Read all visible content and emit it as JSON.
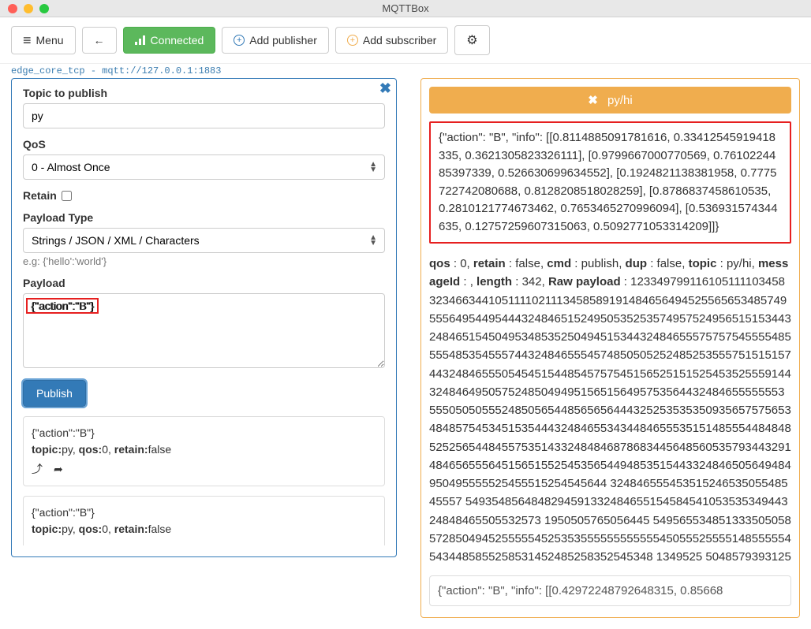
{
  "window": {
    "title": "MQTTBox"
  },
  "toolbar": {
    "menu": "Menu",
    "connected": "Connected",
    "add_publisher": "Add publisher",
    "add_subscriber": "Add subscriber"
  },
  "connstr": "edge_core_tcp - mqtt://127.0.0.1:1883",
  "publisher": {
    "topic_label": "Topic to publish",
    "topic_value": "py",
    "qos_label": "QoS",
    "qos_value": "0 - Almost Once",
    "retain_label": "Retain",
    "payload_type_label": "Payload Type",
    "payload_type_value": "Strings / JSON / XML / Characters",
    "payload_type_hint": "e.g: {'hello':'world'}",
    "payload_label": "Payload",
    "payload_value": "{\"action\":\"B\"}",
    "publish_button": "Publish"
  },
  "history": [
    {
      "payload": "{\"action\":\"B\"}",
      "topic_label": "topic:",
      "topic": "py",
      "qos_label": "qos:",
      "qos": "0",
      "retain_label": "retain:",
      "retain": "false"
    },
    {
      "payload": "{\"action\":\"B\"}",
      "topic_label": "topic:",
      "topic": "py",
      "qos_label": "qos:",
      "qos": "0",
      "retain_label": "retain:",
      "retain": "false"
    }
  ],
  "subscriber": {
    "topic": "py/hi",
    "message": "{\"action\": \"B\", \"info\": [[0.8114885091781616, 0.33412545919418335, 0.3621305823326111], [0.9799667000770569, 0.7610224485397339, 0.526630699634552], [0.1924821138381958, 0.7775722742080688, 0.8128208518028259], [0.8786837458610535, 0.2810121774673462, 0.7653465270996094], [0.536931574344635, 0.12757259607315063, 0.5092771053314209]]}",
    "meta_prefix": "qos : 0, retain : false, cmd : publish, dup : false, topic : py/hi, messageId : , length : 342, Raw payload : ",
    "meta_keys": {
      "qos": "qos",
      "retain": "retain",
      "cmd": "cmd",
      "dup": "dup",
      "topic": "topic",
      "messageId": "messageId",
      "length": "length",
      "raw": "Raw payload"
    },
    "meta_vals": {
      "qos": "0",
      "retain": "false",
      "cmd": "publish",
      "dup": "false",
      "topic": "py/hi",
      "messageId": "",
      "length": "342"
    },
    "raw_payload": "12334979911610511110345832346634410511110211134585891914846564945255656534857495556495449544432484651524950535253574957524956515153443248465154504953485352504945153443248465557575754555548555548535455574432484655545748505052524852535557515151574432484655505454515448545757545156525151525453525559144324846495057524850494951565156495753564432484655555553 5550505055524850565448565656444325253535350935657575653484857545345153544432484655343448465553515148555448484852525654484557535143324848468786834456485605357934432914846565556451565155254535654494853515443324846505649484950495555525455515254545644 32484655545351524653505548545557 549354856484829459133248465515458454105353534944324848465505532573 1950505765056445 54956553485133350505857285049452555554525353555555555555450555255551485555545434485855258531452485258352545348 1349525 5048579393125",
    "truncated_next": "{\"action\": \"B\", \"info\": [[0.42972248792648315, 0.85668"
  }
}
